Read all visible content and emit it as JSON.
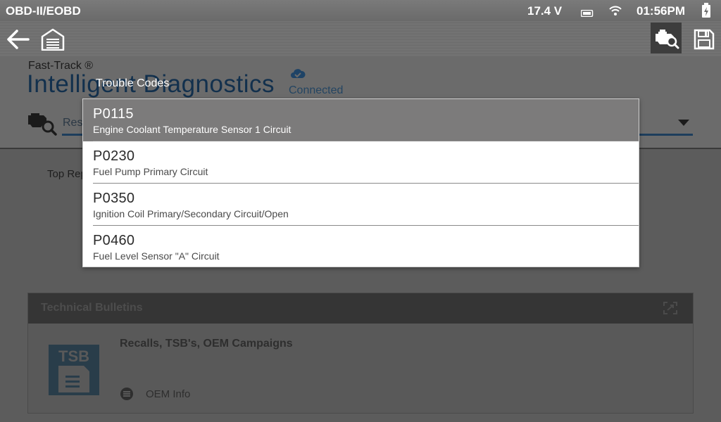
{
  "status_bar": {
    "protocol": "OBD-II/EOBD",
    "voltage": "17.4 V",
    "time": "01:56PM"
  },
  "toolbar": {
    "back_icon": "back-arrow-icon",
    "home_icon": "garage-home-icon",
    "vehicle_scan_icon": "engine-search-icon",
    "save_icon": "save-icon"
  },
  "header": {
    "brand": "Fast-Track ®",
    "title": "Intelligent Diagnostics",
    "connection_status": "Connected",
    "selector_text": "Res"
  },
  "body": {
    "top_repairs_label": "Top Rep",
    "bulletins": {
      "title": "Technical Bulletins",
      "tsb_icon_text": "TSB",
      "headline": "Recalls, TSB's, OEM Campaigns",
      "link": "OEM Info"
    }
  },
  "dialog": {
    "title": "Trouble Codes",
    "codes": [
      {
        "code": "P0115",
        "description": "Engine Coolant Temperature Sensor 1 Circuit"
      },
      {
        "code": "P0230",
        "description": "Fuel Pump Primary Circuit"
      },
      {
        "code": "P0350",
        "description": "Ignition Coil Primary/Secondary Circuit/Open"
      },
      {
        "code": "P0460",
        "description": "Fuel Level Sensor \"A\" Circuit"
      }
    ]
  }
}
